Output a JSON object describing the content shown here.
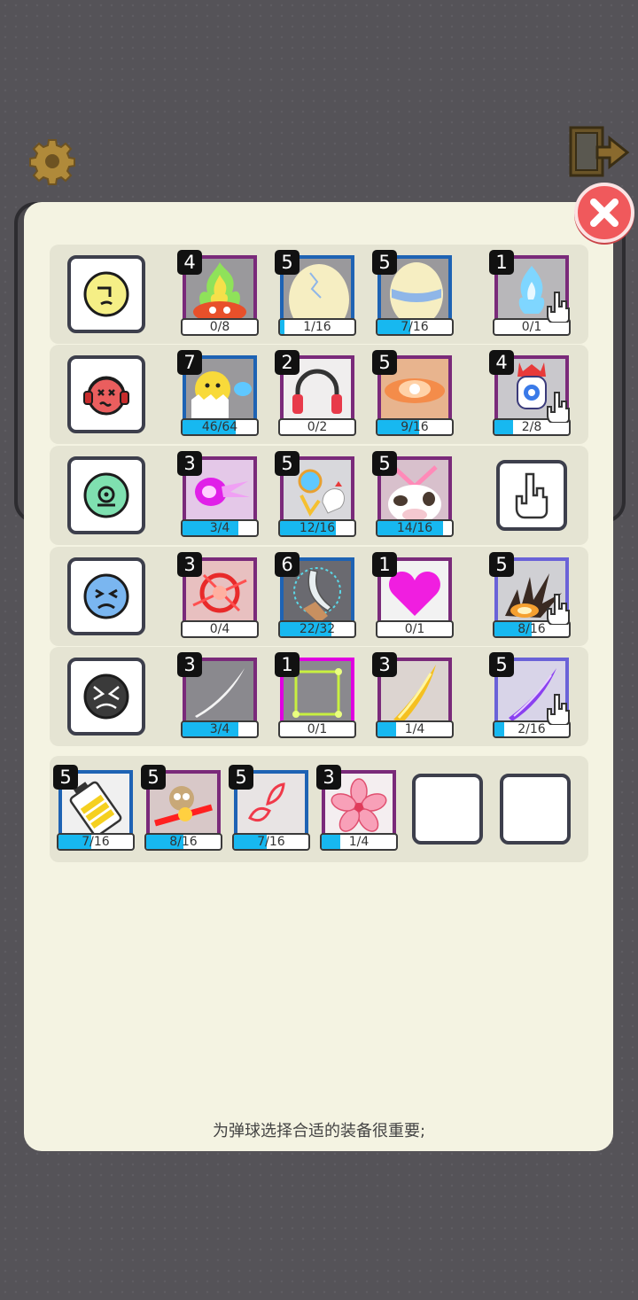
{
  "icons": {
    "settings": "gear-icon",
    "exit": "exit-door-icon",
    "close": "close-icon"
  },
  "colors": {
    "progress_fill": "#17b8f0",
    "close_button": "#f0595c",
    "panel": "#f4f3e2"
  },
  "rows": [
    {
      "face_icon": "neutral-face-icon",
      "slots": [
        {
          "level": "4",
          "progress": "0/8",
          "fraction": 0.0,
          "icon": "green-fire-icon"
        },
        {
          "level": "5",
          "progress": "1/16",
          "fraction": 0.0625,
          "icon": "cracked-egg-icon"
        },
        {
          "level": "5",
          "progress": "7/16",
          "fraction": 0.4375,
          "icon": "blue-striped-egg-icon"
        },
        {
          "level": "1",
          "progress": "0/1",
          "fraction": 0.0,
          "icon": "blue-flame-icon"
        }
      ]
    },
    {
      "face_icon": "dizzy-headphone-face-icon",
      "slots": [
        {
          "level": "7",
          "progress": "46/64",
          "fraction": 0.71875,
          "icon": "chick-egg-icon"
        },
        {
          "level": "2",
          "progress": "0/2",
          "fraction": 0.0,
          "icon": "headphones-icon"
        },
        {
          "level": "5",
          "progress": "9/16",
          "fraction": 0.5625,
          "icon": "orange-vortex-icon"
        },
        {
          "level": "4",
          "progress": "2/8",
          "fraction": 0.25,
          "icon": "robot-icon"
        }
      ]
    },
    {
      "face_icon": "surprised-face-icon",
      "slots": [
        {
          "level": "3",
          "progress": "3/4",
          "fraction": 0.75,
          "icon": "purple-blast-icon"
        },
        {
          "level": "5",
          "progress": "12/16",
          "fraction": 0.75,
          "icon": "chicken-orb-icon"
        },
        {
          "level": "5",
          "progress": "14/16",
          "fraction": 0.875,
          "icon": "cow-icon"
        }
      ]
    },
    {
      "face_icon": "sad-face-icon",
      "slots": [
        {
          "level": "3",
          "progress": "0/4",
          "fraction": 0.0,
          "icon": "red-burst-icon"
        },
        {
          "level": "6",
          "progress": "22/32",
          "fraction": 0.6875,
          "icon": "scimitar-icon"
        },
        {
          "level": "1",
          "progress": "0/1",
          "fraction": 0.0,
          "icon": "heart-icon"
        },
        {
          "level": "5",
          "progress": "8/16",
          "fraction": 0.5,
          "icon": "explosion-icon"
        }
      ]
    },
    {
      "face_icon": "angry-face-icon",
      "slots": [
        {
          "level": "3",
          "progress": "3/4",
          "fraction": 0.75,
          "icon": "white-slash-icon"
        },
        {
          "level": "1",
          "progress": "0/1",
          "fraction": 0.0,
          "icon": "green-square-icon"
        },
        {
          "level": "3",
          "progress": "1/4",
          "fraction": 0.25,
          "icon": "yellow-slash-icon"
        },
        {
          "level": "5",
          "progress": "2/16",
          "fraction": 0.125,
          "icon": "purple-slash-icon"
        }
      ]
    }
  ],
  "equipment": [
    {
      "level": "5",
      "progress": "7/16",
      "fraction": 0.4375,
      "icon": "battery-icon"
    },
    {
      "level": "5",
      "progress": "8/16",
      "fraction": 0.5,
      "icon": "owl-laser-icon"
    },
    {
      "level": "5",
      "progress": "7/16",
      "fraction": 0.4375,
      "icon": "petal-icon"
    },
    {
      "level": "3",
      "progress": "1/4",
      "fraction": 0.25,
      "icon": "sakura-flower-icon"
    }
  ],
  "footer": {
    "tip": "为弹球选择合适的装备很重要;"
  }
}
